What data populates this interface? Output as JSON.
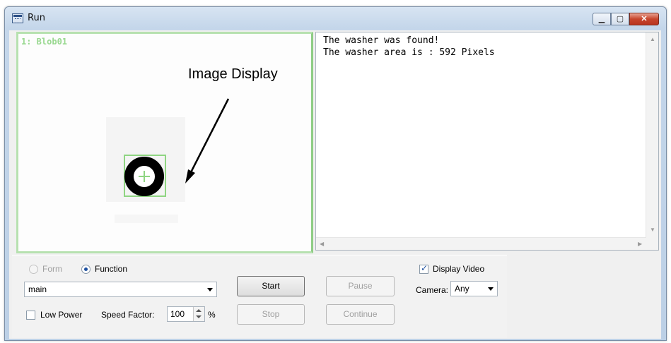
{
  "window": {
    "title": "Run",
    "controls": {
      "minimize": "▁",
      "maximize": "▢",
      "close": "✕"
    }
  },
  "image_display": {
    "blob_label": "1: Blob01",
    "annotation": "Image Display"
  },
  "output": {
    "lines": [
      "The washer was found!",
      "The washer area is : 592 Pixels"
    ],
    "scroll_up": "▲",
    "scroll_down": "▼",
    "scroll_left": "◀",
    "scroll_right": "▶"
  },
  "controls": {
    "radio_form": {
      "label": "Form",
      "checked": false,
      "enabled": false
    },
    "radio_function": {
      "label": "Function",
      "checked": true,
      "enabled": true
    },
    "function_select": {
      "value": "main"
    },
    "low_power": {
      "label": "Low Power",
      "checked": false
    },
    "speed_factor": {
      "label": "Speed Factor:",
      "value": "100",
      "unit": "%"
    },
    "buttons": {
      "start": "Start",
      "stop": "Stop",
      "pause": "Pause",
      "continue": "Continue"
    },
    "display_video": {
      "label": "Display Video",
      "checked": true
    },
    "camera": {
      "label": "Camera:",
      "value": "Any"
    }
  },
  "icons": {
    "window_icon": "run-window-icon",
    "arrow": "annotation-arrow"
  }
}
